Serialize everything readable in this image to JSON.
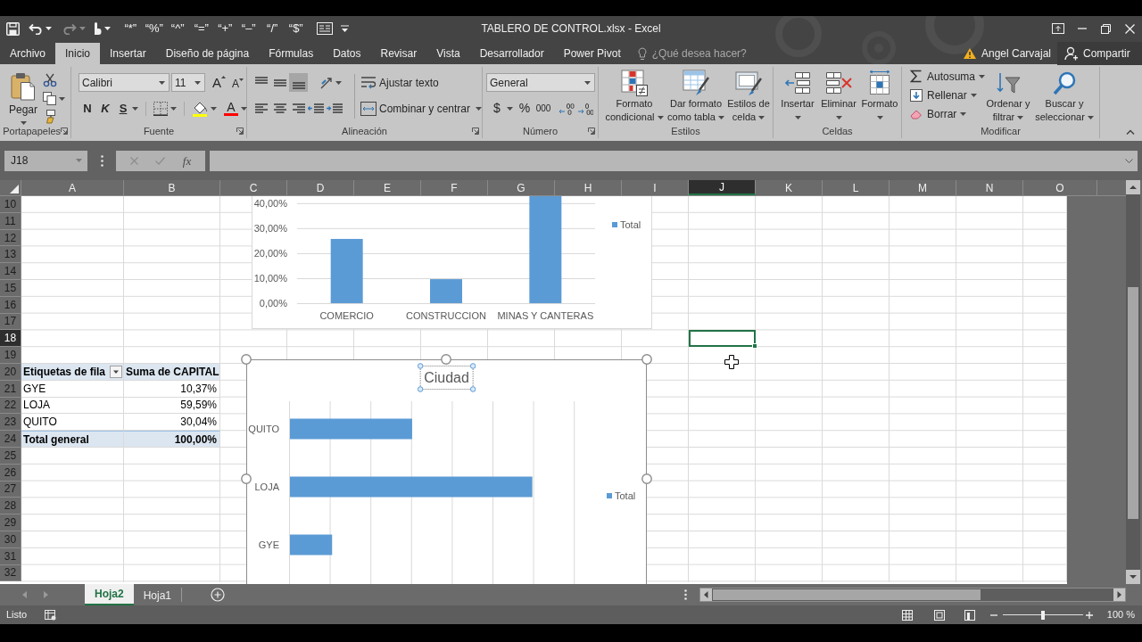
{
  "window": {
    "title": "TABLERO DE CONTROL.xlsx - Excel"
  },
  "quick_access": {
    "redo": {
      "disabled": true
    },
    "symbols": [
      "“*”",
      "“%”",
      "“^”",
      "“=”",
      "“+”",
      "“–”",
      "“/”",
      "“$”"
    ]
  },
  "tabs": [
    {
      "label": "Archivo",
      "selected": false
    },
    {
      "label": "Inicio",
      "selected": true
    },
    {
      "label": "Insertar",
      "selected": false
    },
    {
      "label": "Diseño de página",
      "selected": false
    },
    {
      "label": "Fórmulas",
      "selected": false
    },
    {
      "label": "Datos",
      "selected": false
    },
    {
      "label": "Revisar",
      "selected": false
    },
    {
      "label": "Vista",
      "selected": false
    },
    {
      "label": "Desarrollador",
      "selected": false
    },
    {
      "label": "Power Pivot",
      "selected": false
    }
  ],
  "tell_me": {
    "placeholder": "¿Qué desea hacer?"
  },
  "account": {
    "user": "Angel Carvajal",
    "share": "Compartir"
  },
  "ribbon": {
    "clipboard": {
      "label": "Portapapeles",
      "paste": "Pegar"
    },
    "font": {
      "label": "Fuente",
      "name": "Calibri",
      "size": "11",
      "grow": "A",
      "shrink": "A",
      "bold": "N",
      "italic": "K",
      "underline": "S",
      "font_color_letter": "A"
    },
    "alignment": {
      "label": "Alineación",
      "vertical": [
        {
          "kind": "top",
          "selected": false
        },
        {
          "kind": "middle",
          "selected": false
        },
        {
          "kind": "bottom",
          "selected": true
        }
      ],
      "wrap": "Ajustar texto",
      "merge": "Combinar y centrar"
    },
    "number": {
      "label": "Número",
      "format": "General",
      "currency": "$",
      "percent": "%",
      "thousands": "000"
    },
    "styles": {
      "label": "Estilos",
      "buttons": [
        {
          "kind": "conditional",
          "lines": [
            "Formato",
            "condicional"
          ]
        },
        {
          "kind": "table",
          "lines": [
            "Dar formato",
            "como tabla"
          ]
        },
        {
          "kind": "cell_styles",
          "lines": [
            "Estilos de",
            "celda"
          ]
        }
      ]
    },
    "cells": {
      "label": "Celdas",
      "buttons": [
        {
          "kind": "insert",
          "label": "Insertar"
        },
        {
          "kind": "delete",
          "label": "Eliminar"
        },
        {
          "kind": "format",
          "label": "Formato"
        }
      ]
    },
    "editing": {
      "label": "Modificar",
      "commands": [
        {
          "kind": "sum",
          "label": "Autosuma"
        },
        {
          "kind": "fill",
          "label": "Rellenar"
        },
        {
          "kind": "clear",
          "label": "Borrar"
        }
      ],
      "buttons": [
        {
          "kind": "sort",
          "lines": [
            "Ordenar y",
            "filtrar"
          ]
        },
        {
          "kind": "find",
          "lines": [
            "Buscar y",
            "seleccionar"
          ]
        }
      ]
    }
  },
  "formula_bar": {
    "name_box": "J18",
    "function_label": "fx"
  },
  "sheet": {
    "columns": [
      {
        "label": "A",
        "selected": false
      },
      {
        "label": "B",
        "selected": false
      },
      {
        "label": "C",
        "selected": false
      },
      {
        "label": "D",
        "selected": false
      },
      {
        "label": "E",
        "selected": false
      },
      {
        "label": "F",
        "selected": false
      },
      {
        "label": "G",
        "selected": false
      },
      {
        "label": "H",
        "selected": false
      },
      {
        "label": "I",
        "selected": false
      },
      {
        "label": "J",
        "selected": true
      },
      {
        "label": "K",
        "selected": false
      },
      {
        "label": "L",
        "selected": false
      },
      {
        "label": "M",
        "selected": false
      },
      {
        "label": "N",
        "selected": false
      },
      {
        "label": "O",
        "selected": false
      }
    ],
    "rows": [
      {
        "label": "10",
        "selected": false,
        "kind": "blank"
      },
      {
        "label": "11",
        "selected": false,
        "kind": "blank"
      },
      {
        "label": "12",
        "selected": false,
        "kind": "blank"
      },
      {
        "label": "13",
        "selected": false,
        "kind": "blank"
      },
      {
        "label": "14",
        "selected": false,
        "kind": "blank"
      },
      {
        "label": "15",
        "selected": false,
        "kind": "blank"
      },
      {
        "label": "16",
        "selected": false,
        "kind": "blank"
      },
      {
        "label": "17",
        "selected": false,
        "kind": "blank"
      },
      {
        "label": "18",
        "selected": true,
        "kind": "blank"
      },
      {
        "label": "19",
        "selected": false,
        "kind": "blank"
      },
      {
        "label": "20",
        "selected": false,
        "kind": "pivot_header",
        "cells": [
          "Etiquetas de fila",
          "Suma de CAPITAL"
        ]
      },
      {
        "label": "21",
        "selected": false,
        "kind": "pivot_item",
        "cells": [
          "GYE",
          "10,37%"
        ]
      },
      {
        "label": "22",
        "selected": false,
        "kind": "pivot_item",
        "cells": [
          "LOJA",
          "59,59%"
        ]
      },
      {
        "label": "23",
        "selected": false,
        "kind": "pivot_item",
        "cells": [
          "QUITO",
          "30,04%"
        ]
      },
      {
        "label": "24",
        "selected": false,
        "kind": "pivot_total",
        "cells": [
          "Total general",
          "100,00%"
        ]
      },
      {
        "label": "25",
        "selected": false,
        "kind": "blank"
      },
      {
        "label": "26",
        "selected": false,
        "kind": "blank"
      },
      {
        "label": "27",
        "selected": false,
        "kind": "blank"
      },
      {
        "label": "28",
        "selected": false,
        "kind": "blank"
      },
      {
        "label": "29",
        "selected": false,
        "kind": "blank"
      },
      {
        "label": "30",
        "selected": false,
        "kind": "blank"
      },
      {
        "label": "31",
        "selected": false,
        "kind": "blank"
      },
      {
        "label": "32",
        "selected": false,
        "kind": "blank"
      }
    ]
  },
  "column_chart": {
    "chart_data": {
      "type": "bar",
      "categories": [
        "COMERCIO",
        "CONSTRUCCION",
        "MINAS Y CANTERAS"
      ],
      "series": [
        {
          "name": "Total",
          "color": "#5b9bd5",
          "values": [
            25.7,
            9.6,
            42.8
          ]
        }
      ],
      "ylim": [
        0,
        42.8
      ],
      "yticks": [
        {
          "value": 0,
          "label": "0,00%"
        },
        {
          "value": 10,
          "label": "10,00%"
        },
        {
          "value": 20,
          "label": "20,00%"
        },
        {
          "value": 30,
          "label": "30,00%"
        },
        {
          "value": 40,
          "label": "40,00%"
        }
      ],
      "grid": true,
      "legend": "right"
    }
  },
  "city_chart": {
    "selected": true,
    "title_selected": true,
    "title": "Ciudad",
    "bar_labels": [
      "QUITO",
      "LOJA",
      "GYE"
    ],
    "legend": "Total"
  },
  "sheet_tabs": [
    {
      "label": "Hoja2",
      "selected": true
    },
    {
      "label": "Hoja1",
      "selected": false
    }
  ],
  "status_bar": {
    "status": "Listo",
    "zoom": {
      "level": 0.5,
      "reading": "100 %"
    }
  }
}
